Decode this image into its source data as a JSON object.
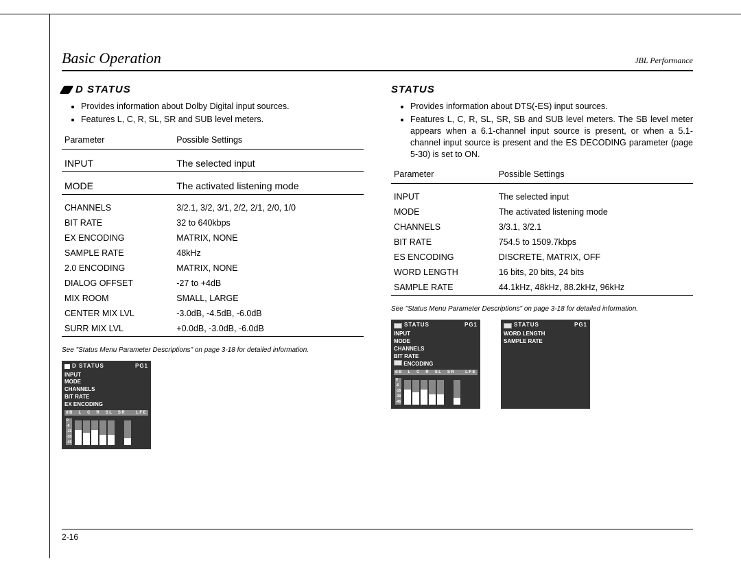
{
  "header": {
    "left": "Basic Operation",
    "right": "JBL Performance"
  },
  "left_section": {
    "title": "D STATUS",
    "bullets": [
      "Provides information about Dolby Digital input sources.",
      "Features L, C, R, SL, SR and SUB level meters."
    ],
    "table_headers": {
      "param": "Parameter",
      "settings": "Possible Settings"
    },
    "rows": [
      {
        "p": "INPUT",
        "s": "The selected input",
        "big": true
      },
      {
        "p": "MODE",
        "s": "The activated listening mode",
        "big": true
      },
      {
        "p": "CHANNELS",
        "s": "3/2.1, 3/2, 3/1, 2/2, 2/1, 2/0, 1/0"
      },
      {
        "p": "BIT RATE",
        "s": "32 to 640kbps"
      },
      {
        "p": "EX ENCODING",
        "s": "MATRIX, NONE"
      },
      {
        "p": "SAMPLE RATE",
        "s": "48kHz"
      },
      {
        "p": "2.0 ENCODING",
        "s": "MATRIX, NONE"
      },
      {
        "p": "DIALOG OFFSET",
        "s": "-27 to +4dB"
      },
      {
        "p": "MIX ROOM",
        "s": "SMALL, LARGE"
      },
      {
        "p": "CENTER MIX LVL",
        "s": "-3.0dB, -4.5dB, -6.0dB"
      },
      {
        "p": "SURR MIX LVL",
        "s": "+0.0dB, -3.0dB, -6.0dB"
      }
    ],
    "caption": "See \"Status Menu Parameter Descriptions\" on page 3-18 for detailed information.",
    "thumb": {
      "title_left": "D STATUS",
      "title_right": "PG1",
      "lines": [
        "INPUT",
        "MODE",
        "CHANNELS",
        "BIT RATE",
        "EX ENCODING"
      ],
      "meter_labels": [
        "dB",
        "L",
        "C",
        "R",
        "SL",
        "SR",
        "",
        "LFE"
      ],
      "scale": [
        "0",
        "-6",
        "-15",
        "-30",
        "-45"
      ]
    }
  },
  "right_section": {
    "title": "STATUS",
    "bullets": [
      "Provides information about DTS(-ES) input sources.",
      "Features L, C, R, SL, SR, SB and SUB level meters. The SB level meter appears when a 6.1-channel input source is present, or when a 5.1-channel input source is present and the ES DECODING parameter (page 5-30) is set to ON."
    ],
    "table_headers": {
      "param": "Parameter",
      "settings": "Possible Settings"
    },
    "rows": [
      {
        "p": "INPUT",
        "s": "The selected input"
      },
      {
        "p": "MODE",
        "s": "The activated listening mode"
      },
      {
        "p": "CHANNELS",
        "s": "3/3.1, 3/2.1"
      },
      {
        "p": "BIT RATE",
        "s": "754.5 to 1509.7kbps"
      },
      {
        "p": "ES ENCODING",
        "s": "DISCRETE, MATRIX, OFF"
      },
      {
        "p": "WORD LENGTH",
        "s": "16 bits, 20 bits, 24 bits"
      },
      {
        "p": "SAMPLE RATE",
        "s": "44.1kHz, 48kHz, 88.2kHz, 96kHz"
      }
    ],
    "caption": "See \"Status Menu Parameter Descriptions\" on page 3-18 for detailed information.",
    "thumbs": [
      {
        "title_left": "STATUS",
        "title_right": "PG1",
        "lines": [
          "INPUT",
          "MODE",
          "CHANNELS",
          "BIT RATE",
          "    ENCODING"
        ],
        "meter_labels": [
          "dB",
          "L",
          "C",
          "R",
          "SL",
          "SR",
          "",
          "LFE"
        ],
        "scale": [
          "0",
          "-6",
          "-15",
          "-30",
          "-45"
        ]
      },
      {
        "title_left": "STATUS",
        "title_right": "PG1",
        "lines": [
          "WORD LENGTH",
          "SAMPLE RATE"
        ]
      }
    ]
  },
  "pagenum": "2-16"
}
